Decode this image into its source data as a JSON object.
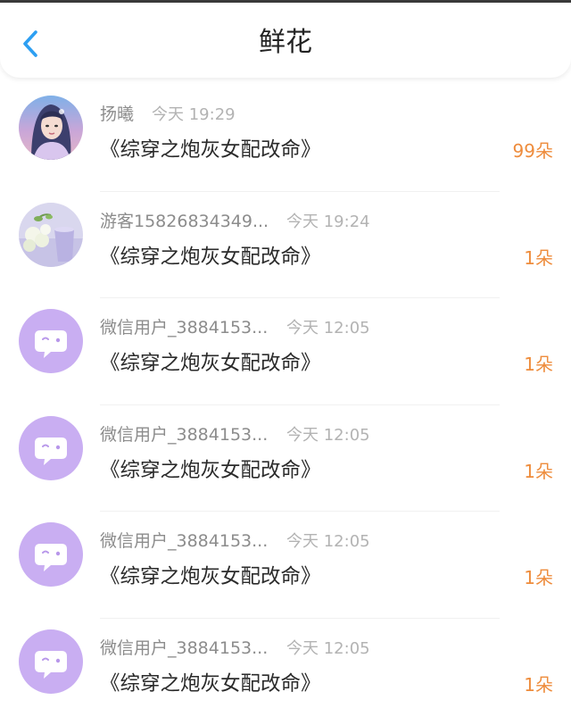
{
  "header": {
    "title": "鲜花",
    "back_icon": "chevron-left-icon",
    "accent_color": "#2d9ff2"
  },
  "colors": {
    "count": "#ee8c3c",
    "name": "#8c8c8c",
    "time": "#b3b3b3",
    "default_avatar_bg": "#c9aef2"
  },
  "entries": [
    {
      "name": "扬曦",
      "time": "今天 19:29",
      "book": "《综穿之炮灰女配改命》",
      "count": "99朵",
      "avatar": "character-portrait"
    },
    {
      "name": "游客15826834349...",
      "time": "今天 19:24",
      "book": "《综穿之炮灰女配改命》",
      "count": "1朵",
      "avatar": "flower-photo"
    },
    {
      "name": "微信用户_3884153...",
      "time": "今天 12:05",
      "book": "《综穿之炮灰女配改命》",
      "count": "1朵",
      "avatar": "default-chat-bubble-icon"
    },
    {
      "name": "微信用户_3884153...",
      "time": "今天 12:05",
      "book": "《综穿之炮灰女配改命》",
      "count": "1朵",
      "avatar": "default-chat-bubble-icon"
    },
    {
      "name": "微信用户_3884153...",
      "time": "今天 12:05",
      "book": "《综穿之炮灰女配改命》",
      "count": "1朵",
      "avatar": "default-chat-bubble-icon"
    },
    {
      "name": "微信用户_3884153...",
      "time": "今天 12:05",
      "book": "《综穿之炮灰女配改命》",
      "count": "1朵",
      "avatar": "default-chat-bubble-icon"
    }
  ]
}
